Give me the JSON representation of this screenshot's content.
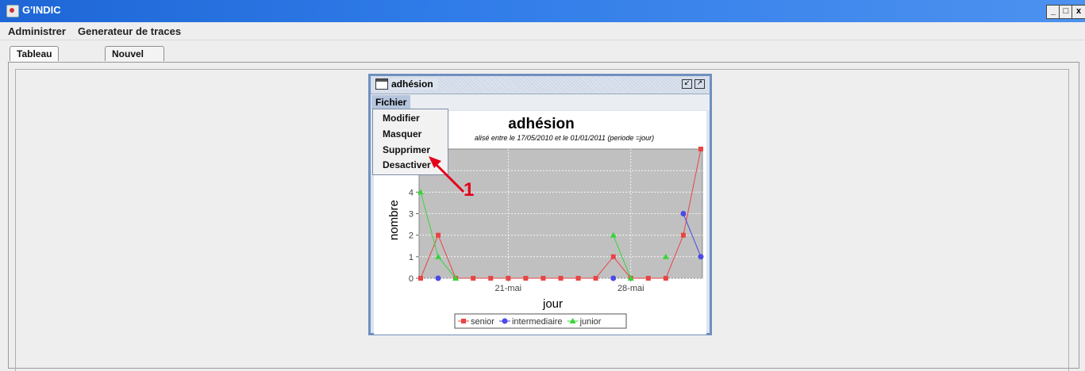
{
  "window": {
    "title": "G'INDIC",
    "controls": [
      "_",
      "□",
      "x"
    ]
  },
  "menubar": {
    "items": [
      "Administrer",
      "Generateur de traces"
    ]
  },
  "tabs": [
    {
      "label": "Tableau de bord"
    },
    {
      "label": "Nouvel Indicateur"
    }
  ],
  "internal_frame": {
    "title": "adhésion",
    "menu": "Fichier",
    "dropdown": [
      "Modifier",
      "Masquer",
      "Supprimer",
      "Desactiver"
    ]
  },
  "annotation": {
    "label": "1",
    "color": "#e4001b"
  },
  "chart_data": {
    "type": "line",
    "title": "adhésion",
    "subtitle": "alisé entre le 17/05/2010 et le 01/01/2011 (periode =jour)",
    "xlabel": "jour",
    "ylabel": "nombre",
    "ylim": [
      0,
      6
    ],
    "yticks": [
      0,
      1,
      2,
      3,
      4,
      5
    ],
    "xtick_labels": [
      {
        "label": "21-mai",
        "index": 5
      },
      {
        "label": "28-mai",
        "index": 12
      }
    ],
    "grid": true,
    "legend_position": "bottom",
    "series": [
      {
        "name": "senior",
        "color": "#e84545",
        "values": [
          0,
          2,
          0,
          0,
          0,
          0,
          0,
          0,
          0,
          0,
          0,
          1,
          0,
          0,
          0,
          2,
          6
        ]
      },
      {
        "name": "intermediaire",
        "color": "#4a4ae6",
        "values": [
          null,
          0,
          null,
          null,
          null,
          null,
          null,
          null,
          null,
          null,
          null,
          0,
          null,
          null,
          null,
          3,
          1
        ]
      },
      {
        "name": "junior",
        "color": "#3ad43a",
        "values": [
          4,
          1,
          0,
          null,
          null,
          null,
          null,
          null,
          null,
          null,
          null,
          2,
          0,
          null,
          1,
          null,
          null
        ]
      }
    ]
  }
}
